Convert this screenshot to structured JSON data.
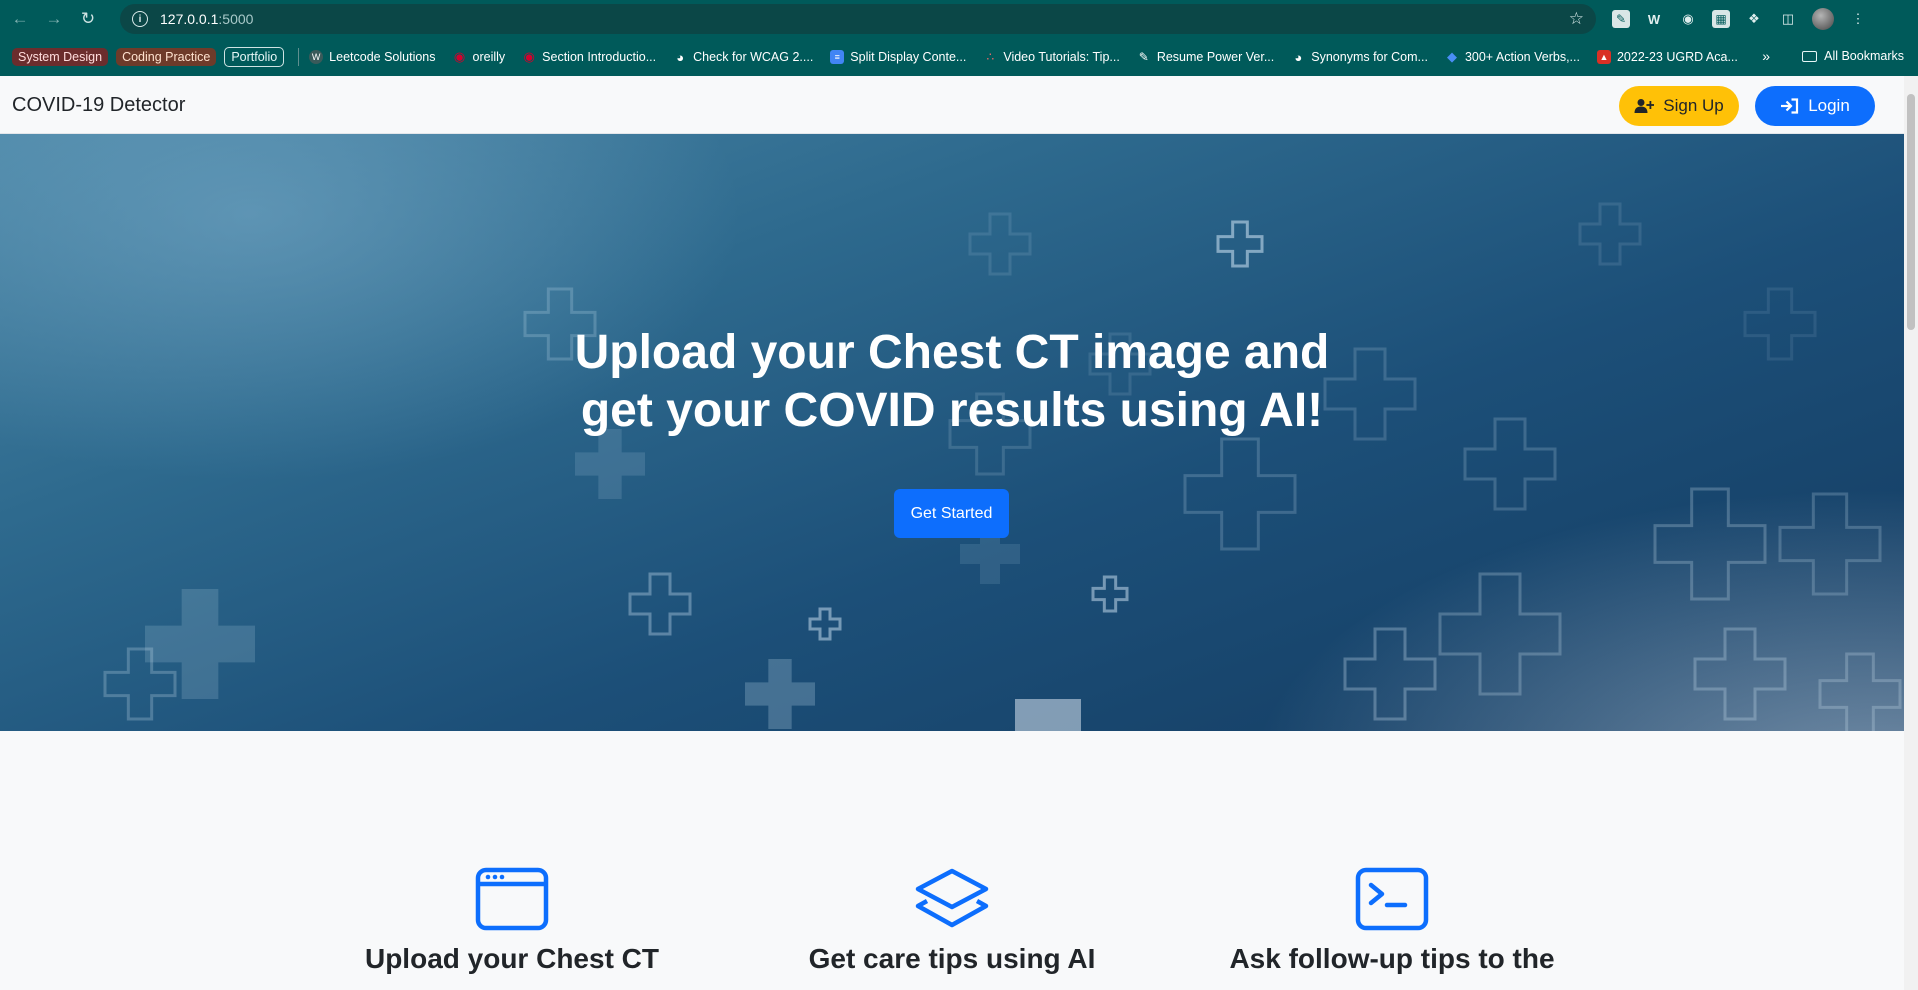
{
  "browser": {
    "url_host": "127.0.0.1",
    "url_port": ":5000",
    "bookmarks": [
      {
        "label": "System Design",
        "style": "chip-red"
      },
      {
        "label": "Coding Practice",
        "style": "chip-brown"
      },
      {
        "label": "Portfolio",
        "style": "chip-outline"
      },
      {
        "label": "Leetcode Solutions",
        "icon": "w-icon"
      },
      {
        "label": "oreilly",
        "icon": "oreilly-icon"
      },
      {
        "label": "Section Introductio...",
        "icon": "oreilly-icon"
      },
      {
        "label": "Check for WCAG 2....",
        "icon": "globe-icon"
      },
      {
        "label": "Split Display Conte...",
        "icon": "doc-icon"
      },
      {
        "label": "Video Tutorials: Tip...",
        "icon": "asana-icon"
      },
      {
        "label": "Resume Power Ver...",
        "icon": "pen-icon"
      },
      {
        "label": "Synonyms for Com...",
        "icon": "globe-icon"
      },
      {
        "label": "300+ Action Verbs,...",
        "icon": "bookmark-icon"
      },
      {
        "label": "2022-23 UGRD Aca...",
        "icon": "pdf-icon"
      }
    ],
    "bookmarks_more": "»",
    "all_bookmarks": "All Bookmarks"
  },
  "navbar": {
    "brand": "COVID-19 Detector",
    "signup_label": "Sign Up",
    "login_label": "Login"
  },
  "hero": {
    "title_line1": "Upload your Chest CT image and",
    "title_line2": "get your COVID results using AI!",
    "cta_label": "Get Started"
  },
  "features": [
    {
      "title": "Upload your Chest CT",
      "icon": "browser-window-icon"
    },
    {
      "title": "Get care tips using AI",
      "icon": "layers-icon"
    },
    {
      "title": "Ask follow-up tips to the",
      "icon": "terminal-icon"
    }
  ],
  "colors": {
    "primary": "#0d6efd",
    "warning": "#ffc107",
    "chrome": "#005a5a"
  }
}
